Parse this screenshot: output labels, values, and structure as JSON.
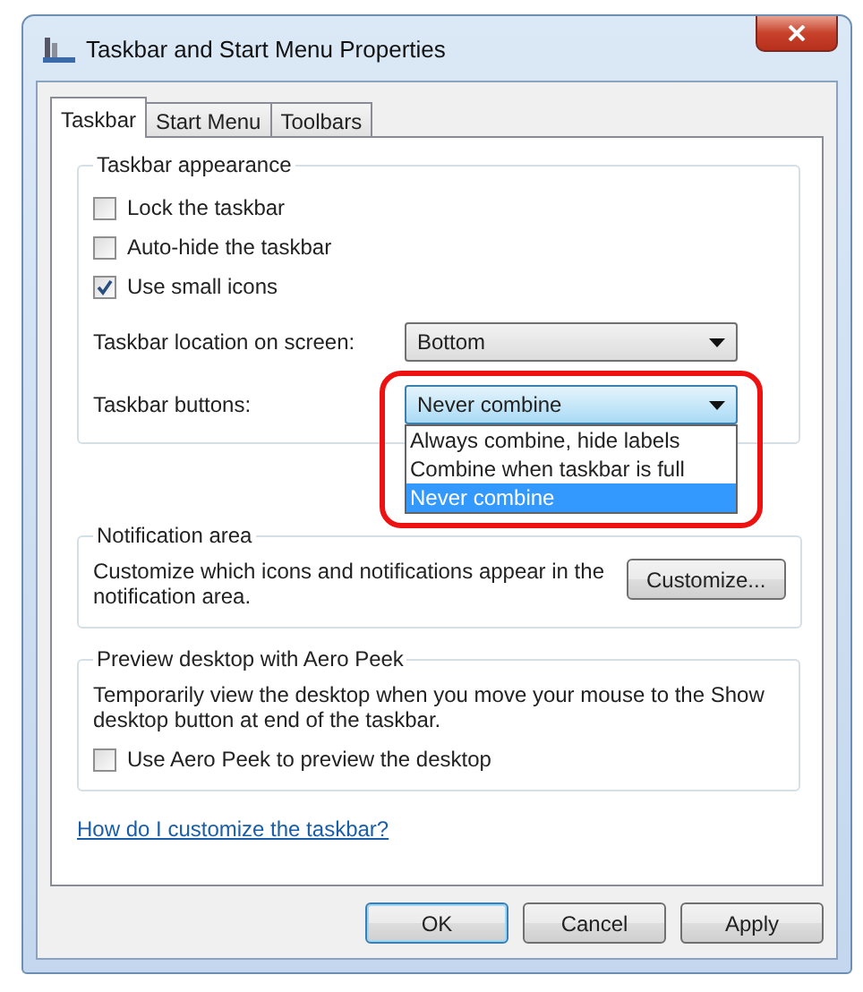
{
  "window": {
    "title": "Taskbar and Start Menu Properties"
  },
  "tabs": [
    {
      "label": "Taskbar",
      "selected": true
    },
    {
      "label": "Start Menu",
      "selected": false
    },
    {
      "label": "Toolbars",
      "selected": false
    }
  ],
  "appearance": {
    "title": "Taskbar appearance",
    "checkboxes": [
      {
        "label": "Lock the taskbar",
        "checked": false
      },
      {
        "label": "Auto-hide the taskbar",
        "checked": false
      },
      {
        "label": "Use small icons",
        "checked": true
      }
    ],
    "location": {
      "label": "Taskbar location on screen:",
      "value": "Bottom"
    },
    "buttons": {
      "label": "Taskbar buttons:",
      "value": "Never combine",
      "expanded": true,
      "highlighted": true,
      "options": [
        {
          "label": "Always combine, hide labels",
          "selected": false
        },
        {
          "label": "Combine when taskbar is full",
          "selected": false
        },
        {
          "label": "Never combine",
          "selected": true
        }
      ]
    }
  },
  "notification": {
    "title": "Notification area",
    "text": "Customize which icons and notifications appear in the notification area.",
    "button": "Customize..."
  },
  "peek": {
    "title": "Preview desktop with Aero Peek",
    "text": "Temporarily view the desktop when you move your mouse to the Show desktop button at end of the taskbar.",
    "checkbox": {
      "label": "Use Aero Peek to preview the desktop",
      "checked": false
    }
  },
  "help_link": "How do I customize the taskbar?",
  "dialog_buttons": [
    {
      "label": "OK",
      "default": true
    },
    {
      "label": "Cancel",
      "default": false
    },
    {
      "label": "Apply",
      "default": false
    }
  ]
}
